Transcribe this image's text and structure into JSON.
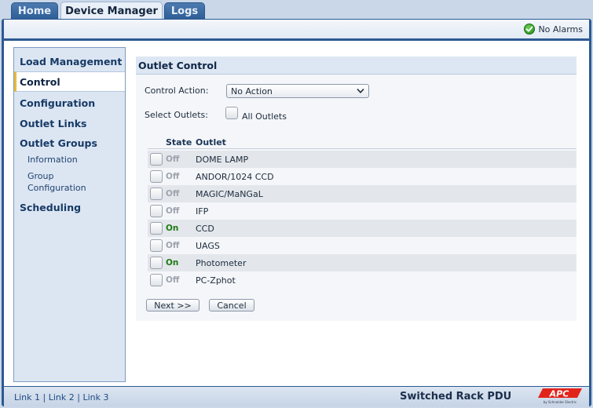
{
  "tabs": [
    {
      "label": "Home",
      "active": false
    },
    {
      "label": "Device Manager",
      "active": true
    },
    {
      "label": "Logs",
      "active": false
    }
  ],
  "status": {
    "alarm_text": "No Alarms",
    "icon": "green-check-icon"
  },
  "sidebar": {
    "items": [
      {
        "label": "Load Management"
      },
      {
        "label": "Control",
        "selected": true
      },
      {
        "label": "Configuration"
      },
      {
        "label": "Outlet Links"
      },
      {
        "label": "Outlet Groups"
      }
    ],
    "sub_items": [
      {
        "label": "Information"
      },
      {
        "label": "Group Configuration"
      }
    ],
    "last_item": {
      "label": "Scheduling"
    }
  },
  "content": {
    "title": "Outlet Control",
    "control_action_label": "Control Action:",
    "control_action_value": "No Action",
    "select_outlets_label": "Select Outlets:",
    "all_outlets_label": "All Outlets",
    "table": {
      "headers": {
        "state": "State",
        "outlet": "Outlet"
      },
      "rows": [
        {
          "state": "Off",
          "name": "DOME LAMP"
        },
        {
          "state": "Off",
          "name": "ANDOR/1024 CCD"
        },
        {
          "state": "Off",
          "name": "MAGIC/MaNGaL"
        },
        {
          "state": "Off",
          "name": "IFP"
        },
        {
          "state": "On",
          "name": "CCD"
        },
        {
          "state": "Off",
          "name": "UAGS"
        },
        {
          "state": "On",
          "name": "Photometer"
        },
        {
          "state": "Off",
          "name": "PC-Zphot"
        }
      ]
    },
    "next_button": "Next >>",
    "cancel_button": "Cancel"
  },
  "footer": {
    "links": [
      "Link 1",
      "Link 2",
      "Link 3"
    ],
    "separator": "|",
    "product_name": "Switched Rack PDU",
    "logo_text": "APC",
    "logo_subtext": "by Schneider Electric"
  },
  "colors": {
    "accent": "#2c5a92",
    "on_state": "#1d7a12",
    "off_state": "#9da4ad",
    "logo_red": "#e2231a"
  }
}
